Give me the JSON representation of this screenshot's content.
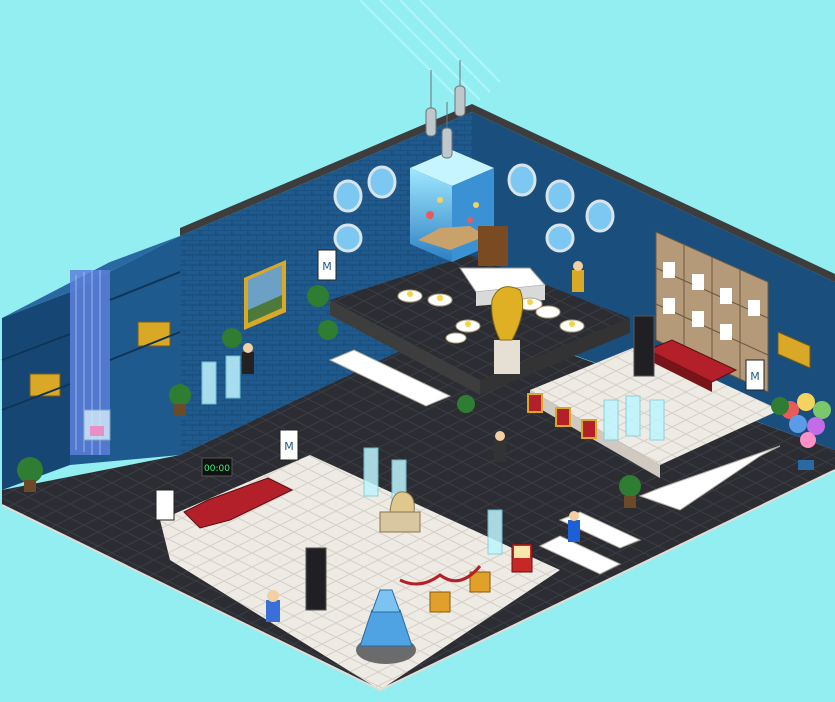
{
  "scene": {
    "type": "isometric-game-room",
    "background_color": "#93eef2",
    "wall_color": "#1f5a8e",
    "wall_dark_color": "#153f66",
    "wall_cap_color": "#3d3d3d",
    "dark_floor_color": "#2c2d33",
    "light_floor_color": "#eeeae4",
    "accent_red": "#b3202a",
    "accent_gold": "#d8a826"
  },
  "signs": {
    "clock_readout": "00:00",
    "banner_letter": "M"
  },
  "icons": [
    "aquarium-tank",
    "ceiling-spotlight",
    "porthole-window",
    "waterfall",
    "framed-painting",
    "banner-flag",
    "red-sofa",
    "white-bench",
    "cafe-table",
    "golden-fish-statue",
    "sphinx-statue",
    "water-fountain",
    "balloon-bunch",
    "potted-plant",
    "avatar",
    "popcorn-machine",
    "digital-clock",
    "glass-door"
  ]
}
